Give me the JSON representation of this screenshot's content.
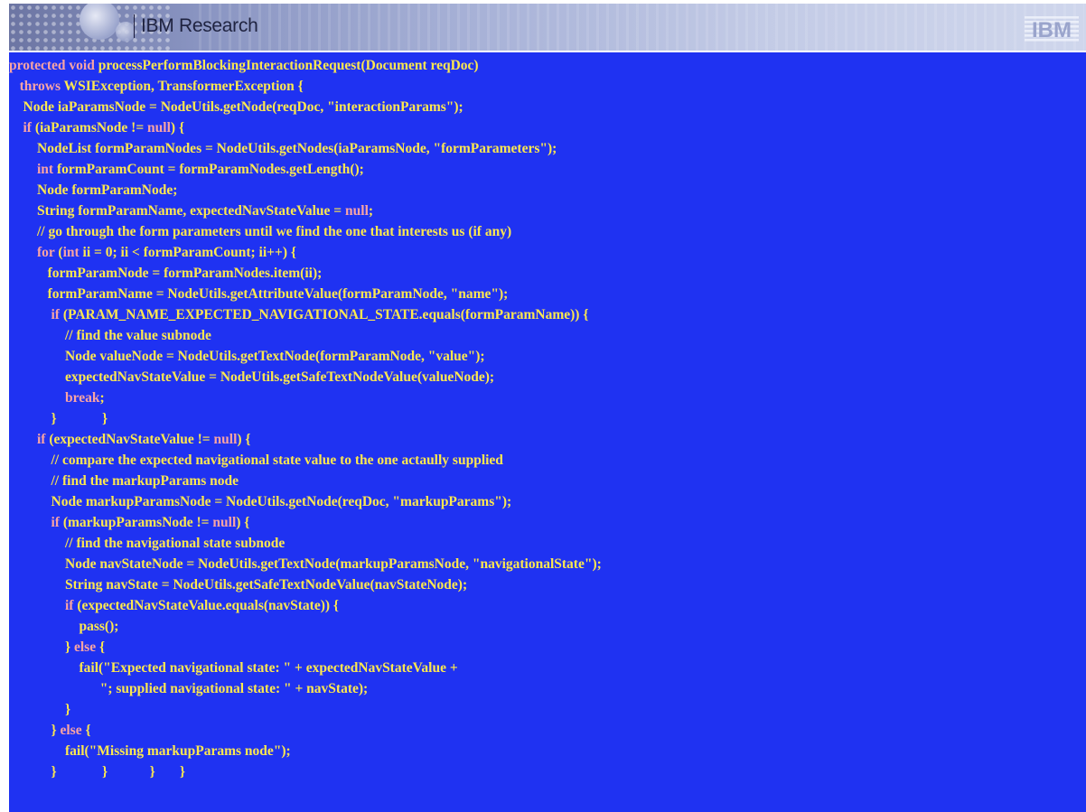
{
  "header": {
    "title": "IBM Research",
    "logo_text": "IBM"
  },
  "colors": {
    "code_background": "#1f32f2",
    "code_text": "#fde84f",
    "keyword": "#f8a4a4",
    "banner": "#8a95c2"
  },
  "code": {
    "lines": [
      {
        "indent": "",
        "parts": [
          {
            "t": "protected void",
            "k": 1
          },
          {
            "t": " processPerformBlockingInteractionRequest(Document reqDoc)",
            "k": 0
          }
        ]
      },
      {
        "indent": "   ",
        "parts": [
          {
            "t": "throws",
            "k": 1
          },
          {
            "t": " WSIException, TransformerException {",
            "k": 0
          }
        ]
      },
      {
        "indent": "    ",
        "parts": [
          {
            "t": "Node iaParamsNode = NodeUtils.getNode(reqDoc, \"interactionParams\");",
            "k": 0
          }
        ]
      },
      {
        "indent": "    ",
        "parts": [
          {
            "t": "if",
            "k": 1
          },
          {
            "t": " (iaParamsNode != ",
            "k": 0
          },
          {
            "t": "null",
            "k": 1
          },
          {
            "t": ") {",
            "k": 0
          }
        ]
      },
      {
        "indent": "        ",
        "parts": [
          {
            "t": "NodeList formParamNodes = NodeUtils.getNodes(iaParamsNode, \"formParameters\");",
            "k": 0
          }
        ]
      },
      {
        "indent": "        ",
        "parts": [
          {
            "t": "int",
            "k": 1
          },
          {
            "t": " formParamCount = formParamNodes.getLength();",
            "k": 0
          }
        ]
      },
      {
        "indent": "        ",
        "parts": [
          {
            "t": "Node formParamNode;",
            "k": 0
          }
        ]
      },
      {
        "indent": "        ",
        "parts": [
          {
            "t": "String formParamName, expectedNavStateValue = ",
            "k": 0
          },
          {
            "t": "null",
            "k": 1
          },
          {
            "t": ";",
            "k": 0
          }
        ]
      },
      {
        "indent": "        ",
        "parts": [
          {
            "t": "// go through the form parameters until we find the one that interests us (if any)",
            "k": 0
          }
        ]
      },
      {
        "indent": "        ",
        "parts": [
          {
            "t": "for",
            "k": 1
          },
          {
            "t": " (",
            "k": 0
          },
          {
            "t": "int",
            "k": 1
          },
          {
            "t": " ii = 0; ii < formParamCount; ii++) {",
            "k": 0
          }
        ]
      },
      {
        "indent": "           ",
        "parts": [
          {
            "t": "formParamNode = formParamNodes.item(ii);",
            "k": 0
          }
        ]
      },
      {
        "indent": "           ",
        "parts": [
          {
            "t": "formParamName = NodeUtils.getAttributeValue(formParamNode, \"name\");",
            "k": 0
          }
        ]
      },
      {
        "indent": "            ",
        "parts": [
          {
            "t": "if",
            "k": 1
          },
          {
            "t": " (PARAM_NAME_EXPECTED_NAVIGATIONAL_STATE.equals(formParamName)) {",
            "k": 0
          }
        ]
      },
      {
        "indent": "                ",
        "parts": [
          {
            "t": "// find the value subnode",
            "k": 0
          }
        ]
      },
      {
        "indent": "                ",
        "parts": [
          {
            "t": "Node valueNode = NodeUtils.getTextNode(formParamNode, \"value\");",
            "k": 0
          }
        ]
      },
      {
        "indent": "                ",
        "parts": [
          {
            "t": "expectedNavStateValue = NodeUtils.getSafeTextNodeValue(valueNode);",
            "k": 0
          }
        ]
      },
      {
        "indent": "                ",
        "parts": [
          {
            "t": "break",
            "k": 1
          },
          {
            "t": ";",
            "k": 0
          }
        ]
      },
      {
        "indent": "            ",
        "parts": [
          {
            "t": "}             }",
            "k": 0
          }
        ]
      },
      {
        "indent": "        ",
        "parts": [
          {
            "t": "if",
            "k": 1
          },
          {
            "t": " (expectedNavStateValue != ",
            "k": 0
          },
          {
            "t": "null",
            "k": 1
          },
          {
            "t": ") {",
            "k": 0
          }
        ]
      },
      {
        "indent": "            ",
        "parts": [
          {
            "t": "// compare the expected navigational state value to the one actaully supplied",
            "k": 0
          }
        ]
      },
      {
        "indent": "            ",
        "parts": [
          {
            "t": "// find the markupParams node",
            "k": 0
          }
        ]
      },
      {
        "indent": "            ",
        "parts": [
          {
            "t": "Node markupParamsNode = NodeUtils.getNode(reqDoc, \"markupParams\");",
            "k": 0
          }
        ]
      },
      {
        "indent": "            ",
        "parts": [
          {
            "t": "if",
            "k": 1
          },
          {
            "t": " (markupParamsNode != ",
            "k": 0
          },
          {
            "t": "null",
            "k": 1
          },
          {
            "t": ") {",
            "k": 0
          }
        ]
      },
      {
        "indent": "                ",
        "parts": [
          {
            "t": "// find the navigational state subnode",
            "k": 0
          }
        ]
      },
      {
        "indent": "                ",
        "parts": [
          {
            "t": "Node navStateNode = NodeUtils.getTextNode(markupParamsNode, \"navigationalState\");",
            "k": 0
          }
        ]
      },
      {
        "indent": "                ",
        "parts": [
          {
            "t": "String navState = NodeUtils.getSafeTextNodeValue(navStateNode);",
            "k": 0
          }
        ]
      },
      {
        "indent": "                ",
        "parts": [
          {
            "t": "if",
            "k": 1
          },
          {
            "t": " (expectedNavStateValue.equals(navState)) {",
            "k": 0
          }
        ]
      },
      {
        "indent": "                    ",
        "parts": [
          {
            "t": "pass();",
            "k": 0
          }
        ]
      },
      {
        "indent": "                ",
        "parts": [
          {
            "t": "} ",
            "k": 0
          },
          {
            "t": "else",
            "k": 1
          },
          {
            "t": " {",
            "k": 0
          }
        ]
      },
      {
        "indent": "                    ",
        "parts": [
          {
            "t": "fail(\"Expected navigational state: \" + expectedNavStateValue +",
            "k": 0
          }
        ]
      },
      {
        "indent": "                          ",
        "parts": [
          {
            "t": "\"; supplied navigational state: \" + navState);",
            "k": 0
          }
        ]
      },
      {
        "indent": "                ",
        "parts": [
          {
            "t": "}",
            "k": 0
          }
        ]
      },
      {
        "indent": "            ",
        "parts": [
          {
            "t": "} ",
            "k": 0
          },
          {
            "t": "else",
            "k": 1
          },
          {
            "t": " {",
            "k": 0
          }
        ]
      },
      {
        "indent": "                ",
        "parts": [
          {
            "t": "fail(\"Missing markupParams node\");",
            "k": 0
          }
        ]
      },
      {
        "indent": "            ",
        "parts": [
          {
            "t": "}             }            }       }",
            "k": 0
          }
        ]
      }
    ]
  }
}
